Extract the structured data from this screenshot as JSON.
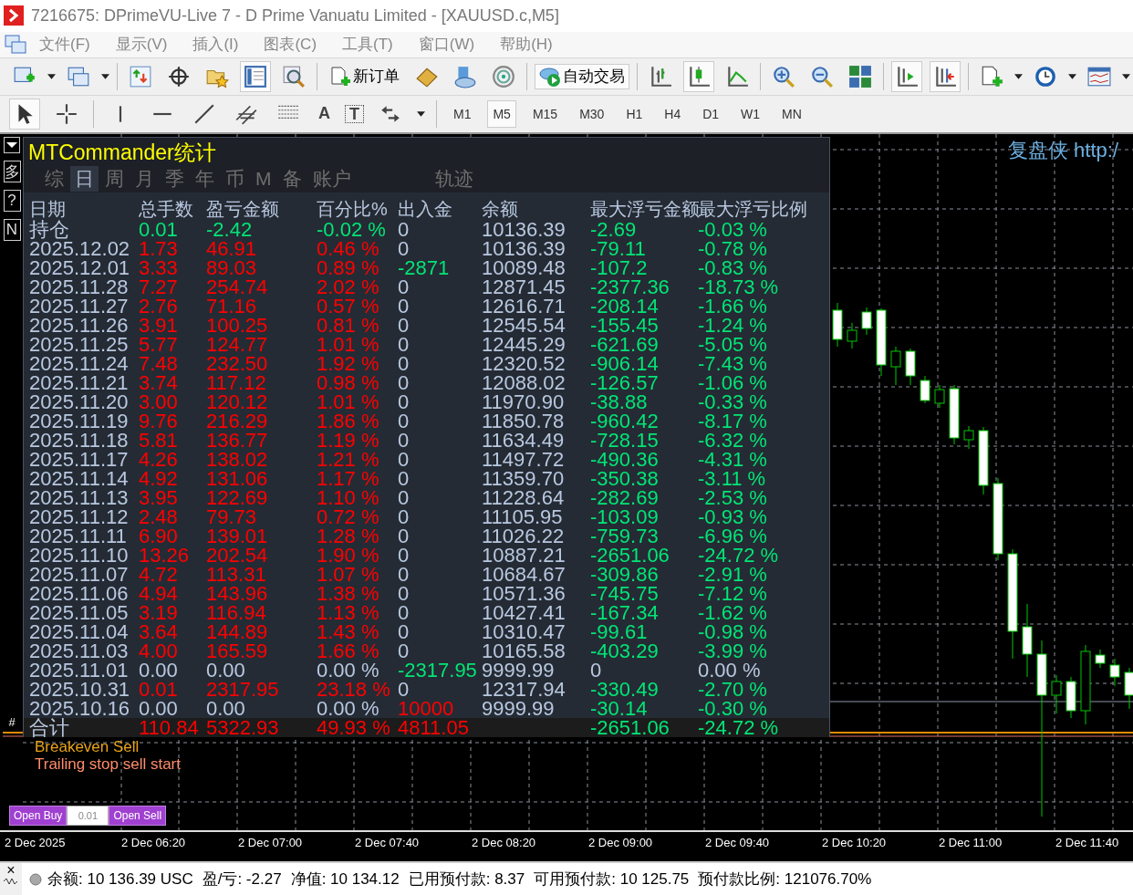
{
  "window": {
    "title": "7216675: DPrimeVU-Live 7 - D Prime Vanuatu Limited - [XAUUSD.c,M5]"
  },
  "menu": [
    "文件(F)",
    "显示(V)",
    "插入(I)",
    "图表(C)",
    "工具(T)",
    "窗口(W)",
    "帮助(H)"
  ],
  "toolbar": {
    "new_order": "新订单",
    "auto_trading": "自动交易"
  },
  "drawing_tools": {
    "text_tool": "A",
    "text_label_tool": "T"
  },
  "timeframes": [
    {
      "label": "M1",
      "selected": false
    },
    {
      "label": "M5",
      "selected": true
    },
    {
      "label": "M15",
      "selected": false
    },
    {
      "label": "M30",
      "selected": false
    },
    {
      "label": "H1",
      "selected": false
    },
    {
      "label": "H4",
      "selected": false
    },
    {
      "label": "D1",
      "selected": false
    },
    {
      "label": "W1",
      "selected": false
    },
    {
      "label": "MN",
      "selected": false
    }
  ],
  "side_buttons": [
    "多",
    "?",
    "N"
  ],
  "panel": {
    "title": "MTCommander统计",
    "tabs": [
      {
        "label": "综",
        "selected": false
      },
      {
        "label": "日",
        "selected": true
      },
      {
        "label": "周",
        "selected": false
      },
      {
        "label": "月",
        "selected": false
      },
      {
        "label": "季",
        "selected": false
      },
      {
        "label": "年",
        "selected": false
      },
      {
        "label": "币",
        "selected": false
      },
      {
        "label": "M",
        "selected": false
      },
      {
        "label": "备",
        "selected": false
      },
      {
        "label": "账户",
        "selected": false
      }
    ],
    "trace_tab": "轨迹",
    "columns": [
      "日期",
      "总手数",
      "盈亏金额",
      "百分比%",
      "出入金",
      "余额",
      "最大浮亏金额",
      "最大浮亏比例"
    ],
    "rows": [
      {
        "kind": "data",
        "cells": [
          {
            "text": "持仓",
            "color": "#b8c8e0"
          },
          {
            "text": "0.01",
            "color": "#00e676"
          },
          {
            "text": "-2.42",
            "color": "#00e676"
          },
          {
            "text": "-0.02 %",
            "color": "#00e676"
          },
          {
            "text": "0",
            "color": "#b8c8e0"
          },
          {
            "text": "10136.39",
            "color": "#b8c8e0"
          },
          {
            "text": "-2.69",
            "color": "#00e676"
          },
          {
            "text": "-0.03 %",
            "color": "#00e676"
          }
        ]
      },
      {
        "kind": "data",
        "cells": [
          {
            "text": "2025.12.02",
            "color": "#b8c8e0"
          },
          {
            "text": "1.73",
            "color": "#ff0000"
          },
          {
            "text": "46.91",
            "color": "#ff0000"
          },
          {
            "text": "0.46 %",
            "color": "#ff0000"
          },
          {
            "text": "0",
            "color": "#b8c8e0"
          },
          {
            "text": "10136.39",
            "color": "#b8c8e0"
          },
          {
            "text": "-79.11",
            "color": "#00e676"
          },
          {
            "text": "-0.78 %",
            "color": "#00e676"
          }
        ]
      },
      {
        "kind": "data",
        "cells": [
          {
            "text": "2025.12.01",
            "color": "#b8c8e0"
          },
          {
            "text": "3.33",
            "color": "#ff0000"
          },
          {
            "text": "89.03",
            "color": "#ff0000"
          },
          {
            "text": "0.89 %",
            "color": "#ff0000"
          },
          {
            "text": "-2871",
            "color": "#00e676"
          },
          {
            "text": "10089.48",
            "color": "#b8c8e0"
          },
          {
            "text": "-107.2",
            "color": "#00e676"
          },
          {
            "text": "-0.83 %",
            "color": "#00e676"
          }
        ]
      },
      {
        "kind": "data",
        "cells": [
          {
            "text": "2025.11.28",
            "color": "#b8c8e0"
          },
          {
            "text": "7.27",
            "color": "#ff0000"
          },
          {
            "text": "254.74",
            "color": "#ff0000"
          },
          {
            "text": "2.02 %",
            "color": "#ff0000"
          },
          {
            "text": "0",
            "color": "#b8c8e0"
          },
          {
            "text": "12871.45",
            "color": "#b8c8e0"
          },
          {
            "text": "-2377.36",
            "color": "#00e676"
          },
          {
            "text": "-18.73 %",
            "color": "#00e676"
          }
        ]
      },
      {
        "kind": "data",
        "cells": [
          {
            "text": "2025.11.27",
            "color": "#b8c8e0"
          },
          {
            "text": "2.76",
            "color": "#ff0000"
          },
          {
            "text": "71.16",
            "color": "#ff0000"
          },
          {
            "text": "0.57 %",
            "color": "#ff0000"
          },
          {
            "text": "0",
            "color": "#b8c8e0"
          },
          {
            "text": "12616.71",
            "color": "#b8c8e0"
          },
          {
            "text": "-208.14",
            "color": "#00e676"
          },
          {
            "text": "-1.66 %",
            "color": "#00e676"
          }
        ]
      },
      {
        "kind": "data",
        "cells": [
          {
            "text": "2025.11.26",
            "color": "#b8c8e0"
          },
          {
            "text": "3.91",
            "color": "#ff0000"
          },
          {
            "text": "100.25",
            "color": "#ff0000"
          },
          {
            "text": "0.81 %",
            "color": "#ff0000"
          },
          {
            "text": "0",
            "color": "#b8c8e0"
          },
          {
            "text": "12545.54",
            "color": "#b8c8e0"
          },
          {
            "text": "-155.45",
            "color": "#00e676"
          },
          {
            "text": "-1.24 %",
            "color": "#00e676"
          }
        ]
      },
      {
        "kind": "data",
        "cells": [
          {
            "text": "2025.11.25",
            "color": "#b8c8e0"
          },
          {
            "text": "5.77",
            "color": "#ff0000"
          },
          {
            "text": "124.77",
            "color": "#ff0000"
          },
          {
            "text": "1.01 %",
            "color": "#ff0000"
          },
          {
            "text": "0",
            "color": "#b8c8e0"
          },
          {
            "text": "12445.29",
            "color": "#b8c8e0"
          },
          {
            "text": "-621.69",
            "color": "#00e676"
          },
          {
            "text": "-5.05 %",
            "color": "#00e676"
          }
        ]
      },
      {
        "kind": "data",
        "cells": [
          {
            "text": "2025.11.24",
            "color": "#b8c8e0"
          },
          {
            "text": "7.48",
            "color": "#ff0000"
          },
          {
            "text": "232.50",
            "color": "#ff0000"
          },
          {
            "text": "1.92 %",
            "color": "#ff0000"
          },
          {
            "text": "0",
            "color": "#b8c8e0"
          },
          {
            "text": "12320.52",
            "color": "#b8c8e0"
          },
          {
            "text": "-906.14",
            "color": "#00e676"
          },
          {
            "text": "-7.43 %",
            "color": "#00e676"
          }
        ]
      },
      {
        "kind": "data",
        "cells": [
          {
            "text": "2025.11.21",
            "color": "#b8c8e0"
          },
          {
            "text": "3.74",
            "color": "#ff0000"
          },
          {
            "text": "117.12",
            "color": "#ff0000"
          },
          {
            "text": "0.98 %",
            "color": "#ff0000"
          },
          {
            "text": "0",
            "color": "#b8c8e0"
          },
          {
            "text": "12088.02",
            "color": "#b8c8e0"
          },
          {
            "text": "-126.57",
            "color": "#00e676"
          },
          {
            "text": "-1.06 %",
            "color": "#00e676"
          }
        ]
      },
      {
        "kind": "data",
        "cells": [
          {
            "text": "2025.11.20",
            "color": "#b8c8e0"
          },
          {
            "text": "3.00",
            "color": "#ff0000"
          },
          {
            "text": "120.12",
            "color": "#ff0000"
          },
          {
            "text": "1.01 %",
            "color": "#ff0000"
          },
          {
            "text": "0",
            "color": "#b8c8e0"
          },
          {
            "text": "11970.90",
            "color": "#b8c8e0"
          },
          {
            "text": "-38.88",
            "color": "#00e676"
          },
          {
            "text": "-0.33 %",
            "color": "#00e676"
          }
        ]
      },
      {
        "kind": "data",
        "cells": [
          {
            "text": "2025.11.19",
            "color": "#b8c8e0"
          },
          {
            "text": "9.76",
            "color": "#ff0000"
          },
          {
            "text": "216.29",
            "color": "#ff0000"
          },
          {
            "text": "1.86 %",
            "color": "#ff0000"
          },
          {
            "text": "0",
            "color": "#b8c8e0"
          },
          {
            "text": "11850.78",
            "color": "#b8c8e0"
          },
          {
            "text": "-960.42",
            "color": "#00e676"
          },
          {
            "text": "-8.17 %",
            "color": "#00e676"
          }
        ]
      },
      {
        "kind": "data",
        "cells": [
          {
            "text": "2025.11.18",
            "color": "#b8c8e0"
          },
          {
            "text": "5.81",
            "color": "#ff0000"
          },
          {
            "text": "136.77",
            "color": "#ff0000"
          },
          {
            "text": "1.19 %",
            "color": "#ff0000"
          },
          {
            "text": "0",
            "color": "#b8c8e0"
          },
          {
            "text": "11634.49",
            "color": "#b8c8e0"
          },
          {
            "text": "-728.15",
            "color": "#00e676"
          },
          {
            "text": "-6.32 %",
            "color": "#00e676"
          }
        ]
      },
      {
        "kind": "data",
        "cells": [
          {
            "text": "2025.11.17",
            "color": "#b8c8e0"
          },
          {
            "text": "4.26",
            "color": "#ff0000"
          },
          {
            "text": "138.02",
            "color": "#ff0000"
          },
          {
            "text": "1.21 %",
            "color": "#ff0000"
          },
          {
            "text": "0",
            "color": "#b8c8e0"
          },
          {
            "text": "11497.72",
            "color": "#b8c8e0"
          },
          {
            "text": "-490.36",
            "color": "#00e676"
          },
          {
            "text": "-4.31 %",
            "color": "#00e676"
          }
        ]
      },
      {
        "kind": "data",
        "cells": [
          {
            "text": "2025.11.14",
            "color": "#b8c8e0"
          },
          {
            "text": "4.92",
            "color": "#ff0000"
          },
          {
            "text": "131.06",
            "color": "#ff0000"
          },
          {
            "text": "1.17 %",
            "color": "#ff0000"
          },
          {
            "text": "0",
            "color": "#b8c8e0"
          },
          {
            "text": "11359.70",
            "color": "#b8c8e0"
          },
          {
            "text": "-350.38",
            "color": "#00e676"
          },
          {
            "text": "-3.11 %",
            "color": "#00e676"
          }
        ]
      },
      {
        "kind": "data",
        "cells": [
          {
            "text": "2025.11.13",
            "color": "#b8c8e0"
          },
          {
            "text": "3.95",
            "color": "#ff0000"
          },
          {
            "text": "122.69",
            "color": "#ff0000"
          },
          {
            "text": "1.10 %",
            "color": "#ff0000"
          },
          {
            "text": "0",
            "color": "#b8c8e0"
          },
          {
            "text": "11228.64",
            "color": "#b8c8e0"
          },
          {
            "text": "-282.69",
            "color": "#00e676"
          },
          {
            "text": "-2.53 %",
            "color": "#00e676"
          }
        ]
      },
      {
        "kind": "data",
        "cells": [
          {
            "text": "2025.11.12",
            "color": "#b8c8e0"
          },
          {
            "text": "2.48",
            "color": "#ff0000"
          },
          {
            "text": "79.73",
            "color": "#ff0000"
          },
          {
            "text": "0.72 %",
            "color": "#ff0000"
          },
          {
            "text": "0",
            "color": "#b8c8e0"
          },
          {
            "text": "11105.95",
            "color": "#b8c8e0"
          },
          {
            "text": "-103.09",
            "color": "#00e676"
          },
          {
            "text": "-0.93 %",
            "color": "#00e676"
          }
        ]
      },
      {
        "kind": "data",
        "cells": [
          {
            "text": "2025.11.11",
            "color": "#b8c8e0"
          },
          {
            "text": "6.90",
            "color": "#ff0000"
          },
          {
            "text": "139.01",
            "color": "#ff0000"
          },
          {
            "text": "1.28 %",
            "color": "#ff0000"
          },
          {
            "text": "0",
            "color": "#b8c8e0"
          },
          {
            "text": "11026.22",
            "color": "#b8c8e0"
          },
          {
            "text": "-759.73",
            "color": "#00e676"
          },
          {
            "text": "-6.96 %",
            "color": "#00e676"
          }
        ]
      },
      {
        "kind": "data",
        "cells": [
          {
            "text": "2025.11.10",
            "color": "#b8c8e0"
          },
          {
            "text": "13.26",
            "color": "#ff0000"
          },
          {
            "text": "202.54",
            "color": "#ff0000"
          },
          {
            "text": "1.90 %",
            "color": "#ff0000"
          },
          {
            "text": "0",
            "color": "#b8c8e0"
          },
          {
            "text": "10887.21",
            "color": "#b8c8e0"
          },
          {
            "text": "-2651.06",
            "color": "#00e676"
          },
          {
            "text": "-24.72 %",
            "color": "#00e676"
          }
        ]
      },
      {
        "kind": "data",
        "cells": [
          {
            "text": "2025.11.07",
            "color": "#b8c8e0"
          },
          {
            "text": "4.72",
            "color": "#ff0000"
          },
          {
            "text": "113.31",
            "color": "#ff0000"
          },
          {
            "text": "1.07 %",
            "color": "#ff0000"
          },
          {
            "text": "0",
            "color": "#b8c8e0"
          },
          {
            "text": "10684.67",
            "color": "#b8c8e0"
          },
          {
            "text": "-309.86",
            "color": "#00e676"
          },
          {
            "text": "-2.91 %",
            "color": "#00e676"
          }
        ]
      },
      {
        "kind": "data",
        "cells": [
          {
            "text": "2025.11.06",
            "color": "#b8c8e0"
          },
          {
            "text": "4.94",
            "color": "#ff0000"
          },
          {
            "text": "143.96",
            "color": "#ff0000"
          },
          {
            "text": "1.38 %",
            "color": "#ff0000"
          },
          {
            "text": "0",
            "color": "#b8c8e0"
          },
          {
            "text": "10571.36",
            "color": "#b8c8e0"
          },
          {
            "text": "-745.75",
            "color": "#00e676"
          },
          {
            "text": "-7.12 %",
            "color": "#00e676"
          }
        ]
      },
      {
        "kind": "data",
        "cells": [
          {
            "text": "2025.11.05",
            "color": "#b8c8e0"
          },
          {
            "text": "3.19",
            "color": "#ff0000"
          },
          {
            "text": "116.94",
            "color": "#ff0000"
          },
          {
            "text": "1.13 %",
            "color": "#ff0000"
          },
          {
            "text": "0",
            "color": "#b8c8e0"
          },
          {
            "text": "10427.41",
            "color": "#b8c8e0"
          },
          {
            "text": "-167.34",
            "color": "#00e676"
          },
          {
            "text": "-1.62 %",
            "color": "#00e676"
          }
        ]
      },
      {
        "kind": "data",
        "cells": [
          {
            "text": "2025.11.04",
            "color": "#b8c8e0"
          },
          {
            "text": "3.64",
            "color": "#ff0000"
          },
          {
            "text": "144.89",
            "color": "#ff0000"
          },
          {
            "text": "1.43 %",
            "color": "#ff0000"
          },
          {
            "text": "0",
            "color": "#b8c8e0"
          },
          {
            "text": "10310.47",
            "color": "#b8c8e0"
          },
          {
            "text": "-99.61",
            "color": "#00e676"
          },
          {
            "text": "-0.98 %",
            "color": "#00e676"
          }
        ]
      },
      {
        "kind": "data",
        "cells": [
          {
            "text": "2025.11.03",
            "color": "#b8c8e0"
          },
          {
            "text": "4.00",
            "color": "#ff0000"
          },
          {
            "text": "165.59",
            "color": "#ff0000"
          },
          {
            "text": "1.66 %",
            "color": "#ff0000"
          },
          {
            "text": "0",
            "color": "#b8c8e0"
          },
          {
            "text": "10165.58",
            "color": "#b8c8e0"
          },
          {
            "text": "-403.29",
            "color": "#00e676"
          },
          {
            "text": "-3.99 %",
            "color": "#00e676"
          }
        ]
      },
      {
        "kind": "data",
        "cells": [
          {
            "text": "2025.11.01",
            "color": "#b8c8e0"
          },
          {
            "text": "0.00",
            "color": "#b8c8e0"
          },
          {
            "text": "0.00",
            "color": "#b8c8e0"
          },
          {
            "text": "0.00 %",
            "color": "#b8c8e0"
          },
          {
            "text": "-2317.95",
            "color": "#00e676"
          },
          {
            "text": "9999.99",
            "color": "#b8c8e0"
          },
          {
            "text": "0",
            "color": "#b8c8e0"
          },
          {
            "text": "0.00 %",
            "color": "#b8c8e0"
          }
        ]
      },
      {
        "kind": "data",
        "cells": [
          {
            "text": "2025.10.31",
            "color": "#b8c8e0"
          },
          {
            "text": "0.01",
            "color": "#ff0000"
          },
          {
            "text": "2317.95",
            "color": "#ff0000"
          },
          {
            "text": "23.18 %",
            "color": "#ff0000"
          },
          {
            "text": "0",
            "color": "#b8c8e0"
          },
          {
            "text": "12317.94",
            "color": "#b8c8e0"
          },
          {
            "text": "-330.49",
            "color": "#00e676"
          },
          {
            "text": "-2.70 %",
            "color": "#00e676"
          }
        ]
      },
      {
        "kind": "data",
        "cells": [
          {
            "text": "2025.10.16",
            "color": "#b8c8e0"
          },
          {
            "text": "0.00",
            "color": "#b8c8e0"
          },
          {
            "text": "0.00",
            "color": "#b8c8e0"
          },
          {
            "text": "0.00 %",
            "color": "#b8c8e0"
          },
          {
            "text": "10000",
            "color": "#ff0000"
          },
          {
            "text": "9999.99",
            "color": "#b8c8e0"
          },
          {
            "text": "-30.14",
            "color": "#00e676"
          },
          {
            "text": "-0.30 %",
            "color": "#00e676"
          }
        ]
      },
      {
        "kind": "total",
        "cells": [
          {
            "text": "合计",
            "color": "#b8c8e0"
          },
          {
            "text": "110.84",
            "color": "#ff0000"
          },
          {
            "text": "5322.93",
            "color": "#ff0000"
          },
          {
            "text": "49.93 %",
            "color": "#ff0000"
          },
          {
            "text": "4811.05",
            "color": "#ff0000"
          },
          null,
          {
            "text": "-2651.06",
            "color": "#00e676"
          },
          {
            "text": "-24.72 %",
            "color": "#00e676"
          }
        ]
      }
    ]
  },
  "chart": {
    "watermark": "复盘侠 http:/",
    "labels": [
      {
        "text": "Breakeven Sell",
        "color": "#e8a317"
      },
      {
        "text": "Trailing stop sell start",
        "color": "#ff8c69"
      }
    ],
    "marker": "#",
    "trade_panel": {
      "buy": "Open Buy",
      "lots": "0.01",
      "sell": "Open Sell"
    },
    "time_axis": [
      "2 Dec 2025",
      "2 Dec 06:20",
      "2 Dec 07:00",
      "2 Dec 07:40",
      "2 Dec 08:20",
      "2 Dec 09:00",
      "2 Dec 09:40",
      "2 Dec 10:20",
      "2 Dec 11:00",
      "2 Dec 11:40"
    ]
  },
  "status_bar": {
    "close": "×",
    "items": [
      "余额: 10 136.39 USC",
      "盈/亏: -2.27",
      "净值: 10 134.12",
      "已用预付款: 8.37",
      "可用预付款: 10 125.75",
      "预付款比例: 121076.70%"
    ]
  }
}
